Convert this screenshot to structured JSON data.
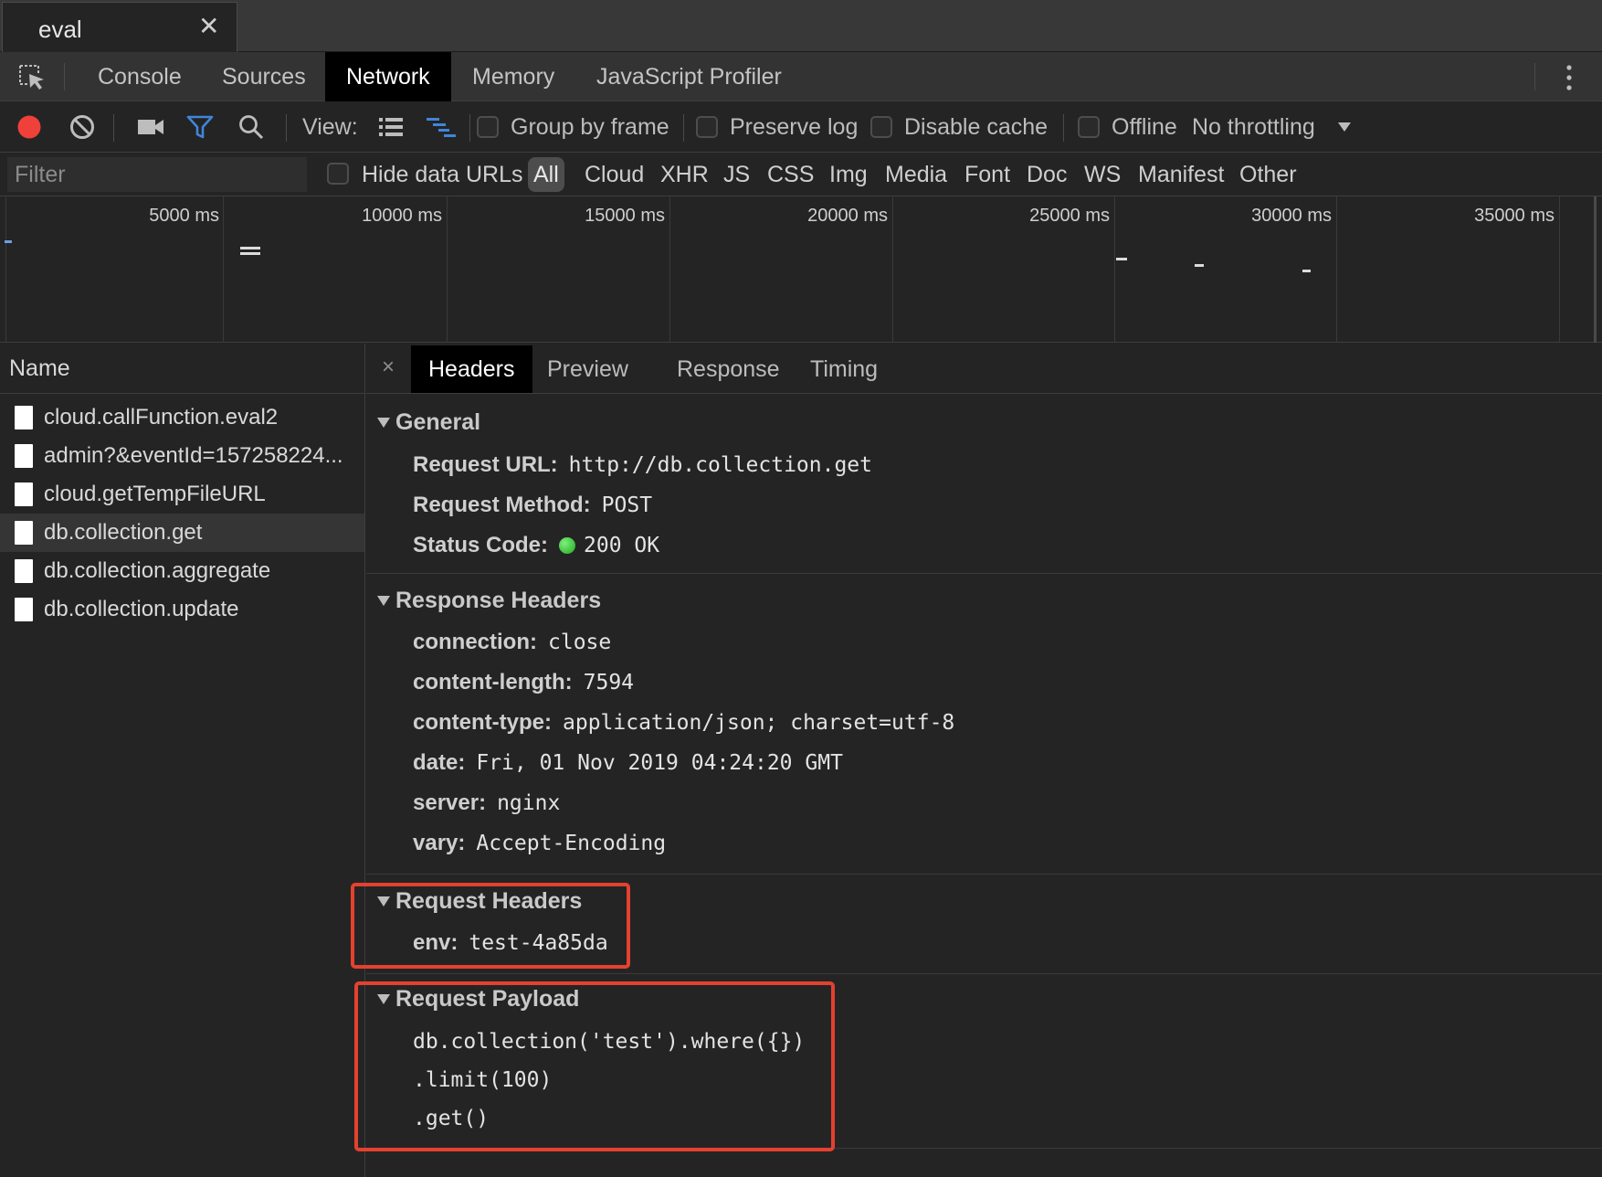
{
  "window_tab": {
    "title": "eval",
    "close": "✕"
  },
  "panel_tabs": [
    "Console",
    "Sources",
    "Network",
    "Memory",
    "JavaScript Profiler"
  ],
  "active_panel": "Network",
  "toolbar": {
    "view_label": "View:",
    "group_by_frame": "Group by frame",
    "preserve_log": "Preserve log",
    "disable_cache": "Disable cache",
    "offline": "Offline",
    "throttling": "No throttling",
    "record_color": "#f0403a",
    "filter_color": "#3f86d9"
  },
  "filterbar": {
    "placeholder": "Filter",
    "hide_data_urls": "Hide data URLs",
    "types": [
      "All",
      "Cloud",
      "XHR",
      "JS",
      "CSS",
      "Img",
      "Media",
      "Font",
      "Doc",
      "WS",
      "Manifest",
      "Other"
    ]
  },
  "overview": {
    "ticks": [
      "5000 ms",
      "10000 ms",
      "15000 ms",
      "20000 ms",
      "25000 ms",
      "30000 ms",
      "35000 ms"
    ]
  },
  "request_list": {
    "header": "Name",
    "rows": [
      "cloud.callFunction.eval2",
      "admin?&eventId=157258224...",
      "cloud.getTempFileURL",
      "db.collection.get",
      "db.collection.aggregate",
      "db.collection.update"
    ],
    "selected_index": 3
  },
  "details": {
    "close": "×",
    "tabs": [
      "Headers",
      "Preview",
      "Response",
      "Timing"
    ],
    "active_tab": "Headers",
    "general": {
      "title": "General",
      "request_url_key": "Request URL:",
      "request_url": "http://db.collection.get",
      "request_method_key": "Request Method:",
      "request_method": "POST",
      "status_code_key": "Status Code:",
      "status_code": "200 OK"
    },
    "response_headers": {
      "title": "Response Headers",
      "items": [
        {
          "key": "connection:",
          "value": "close"
        },
        {
          "key": "content-length:",
          "value": "7594"
        },
        {
          "key": "content-type:",
          "value": "application/json; charset=utf-8"
        },
        {
          "key": "date:",
          "value": "Fri, 01 Nov 2019 04:24:20 GMT"
        },
        {
          "key": "server:",
          "value": "nginx"
        },
        {
          "key": "vary:",
          "value": "Accept-Encoding"
        }
      ]
    },
    "request_headers": {
      "title": "Request Headers",
      "items": [
        {
          "key": "env:",
          "value": "test-4a85da"
        }
      ]
    },
    "request_payload": {
      "title": "Request Payload",
      "lines": [
        "db.collection('test').where({})",
        ".limit(100)",
        ".get()"
      ]
    }
  },
  "highlight_color": "#e4412f"
}
